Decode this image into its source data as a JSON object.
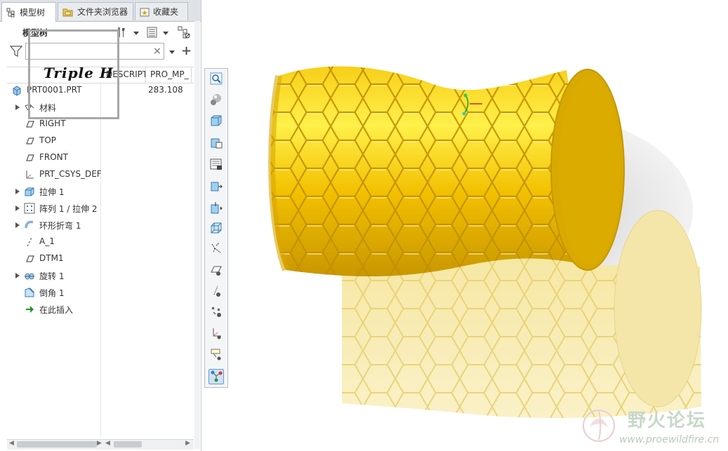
{
  "tabs": [
    {
      "label": "模型树",
      "icon": "model-tree-icon"
    },
    {
      "label": "文件夹浏览器",
      "icon": "folder-browser-icon"
    },
    {
      "label": "收藏夹",
      "icon": "favorites-icon"
    }
  ],
  "toolbar": {
    "title": "模型树",
    "settings_icon": "tools-icon",
    "display_icon": "show-columns-icon",
    "filter_icon": "tree-filter-icon"
  },
  "search": {
    "value": "",
    "clear_glyph": "×",
    "add_glyph": "+"
  },
  "columns": [
    "DESCRIPT",
    "PRO_MP_"
  ],
  "tree": [
    {
      "label": "PRT0001.PRT",
      "value": "283.108",
      "icon": "part-icon",
      "expandable": false,
      "indent": 0
    },
    {
      "label": "材料",
      "value": "",
      "icon": "material-icon",
      "expandable": true,
      "indent": 1
    },
    {
      "label": "RIGHT",
      "value": "",
      "icon": "datum-plane-icon",
      "expandable": false,
      "indent": 1
    },
    {
      "label": "TOP",
      "value": "",
      "icon": "datum-plane-icon",
      "expandable": false,
      "indent": 1
    },
    {
      "label": "FRONT",
      "value": "",
      "icon": "datum-plane-icon",
      "expandable": false,
      "indent": 1
    },
    {
      "label": "PRT_CSYS_DEF",
      "value": "",
      "icon": "csys-icon",
      "expandable": false,
      "indent": 1
    },
    {
      "label": "拉伸 1",
      "value": "",
      "icon": "extrude-icon",
      "expandable": true,
      "indent": 1
    },
    {
      "label": "阵列 1 / 拉伸 2",
      "value": "",
      "icon": "pattern-icon",
      "expandable": true,
      "indent": 1
    },
    {
      "label": "环形折弯 1",
      "value": "",
      "icon": "toroidal-bend-icon",
      "expandable": true,
      "indent": 1
    },
    {
      "label": "A_1",
      "value": "",
      "icon": "datum-axis-icon",
      "expandable": false,
      "indent": 1
    },
    {
      "label": "DTM1",
      "value": "",
      "icon": "datum-plane-icon",
      "expandable": false,
      "indent": 1
    },
    {
      "label": "旋转 1",
      "value": "",
      "icon": "revolve-icon",
      "expandable": true,
      "indent": 1
    },
    {
      "label": "倒角 1",
      "value": "",
      "icon": "chamfer-icon",
      "expandable": false,
      "indent": 1
    },
    {
      "label": "在此插入",
      "value": "",
      "icon": "insert-here-icon",
      "expandable": false,
      "indent": 1
    }
  ],
  "watermark": {
    "text": "Triple H"
  },
  "view_toolbar": [
    "zoom-to-fit-icon",
    "shading-icon",
    "standard-orientation-icon",
    "saved-views-icon",
    "appearance-gallery-icon",
    "section-view-icon",
    "spin-center-icon",
    "display-style-icon",
    "datum-display-icon",
    "plane-display-icon",
    "axis-display-icon",
    "point-display-icon",
    "csys-display-icon",
    "annotation-display-icon",
    "model-tree-connect-icon"
  ],
  "site_logo": {
    "name": "野火论坛",
    "url": "www.proewildfire.cn"
  },
  "colors": {
    "part": "#f2c200",
    "part_light": "#ffe24a",
    "part_dark": "#b88a00",
    "shadow": "#e6e6e6",
    "reflection": "#f7e9a8"
  }
}
